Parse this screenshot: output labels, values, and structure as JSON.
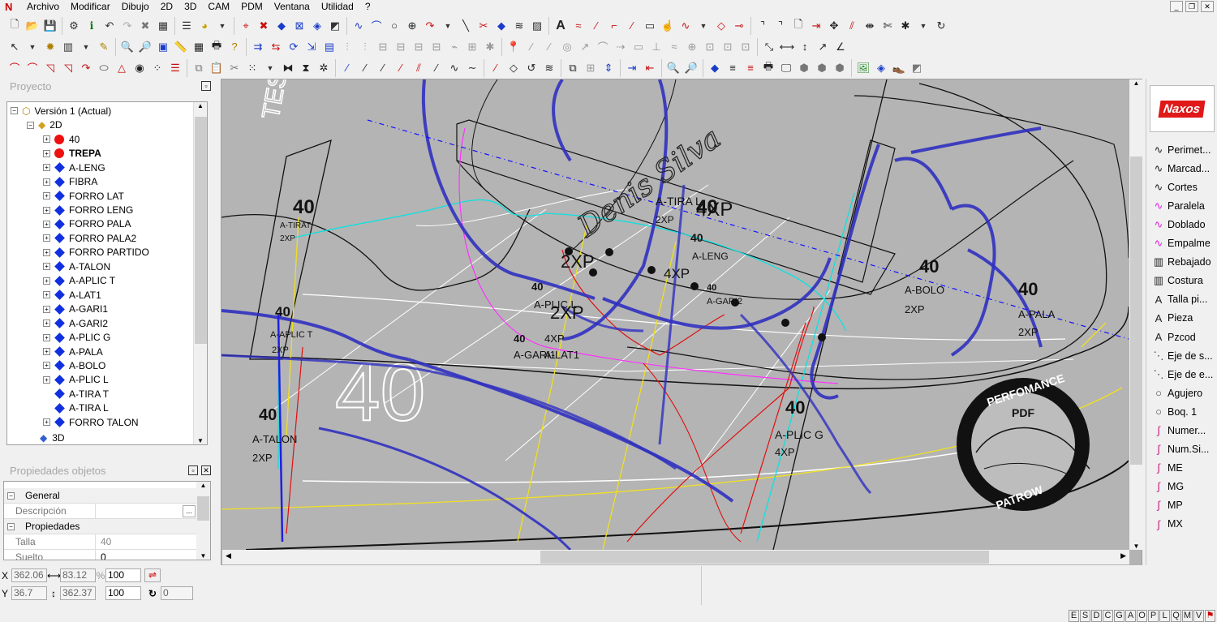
{
  "menu": [
    "Archivo",
    "Modificar",
    "Dibujo",
    "2D",
    "3D",
    "CAM",
    "PDM",
    "Ventana",
    "Utilidad",
    "?"
  ],
  "project_panel": {
    "title": "Proyecto",
    "root": "Versión 1 (Actual)",
    "node_2d": "2D",
    "node_3d": "3D",
    "items": [
      {
        "label": "40",
        "marker": "red-dot",
        "bold": false
      },
      {
        "label": "TREPA",
        "marker": "red-dot",
        "bold": true
      },
      {
        "label": "A-LENG",
        "marker": "blue-diamond",
        "bold": false
      },
      {
        "label": "FIBRA",
        "marker": "blue-diamond",
        "bold": false
      },
      {
        "label": "FORRO LAT",
        "marker": "blue-diamond",
        "bold": false
      },
      {
        "label": "FORRO LENG",
        "marker": "blue-diamond",
        "bold": false
      },
      {
        "label": "FORRO PALA",
        "marker": "blue-diamond",
        "bold": false
      },
      {
        "label": "FORRO PALA2",
        "marker": "blue-diamond",
        "bold": false
      },
      {
        "label": "FORRO PARTIDO",
        "marker": "blue-diamond",
        "bold": false
      },
      {
        "label": "A-TALON",
        "marker": "blue-diamond",
        "bold": false
      },
      {
        "label": "A-APLIC T",
        "marker": "blue-diamond",
        "bold": false
      },
      {
        "label": "A-LAT1",
        "marker": "blue-diamond",
        "bold": false
      },
      {
        "label": "A-GARI1",
        "marker": "blue-diamond",
        "bold": false
      },
      {
        "label": "A-GARI2",
        "marker": "blue-diamond",
        "bold": false
      },
      {
        "label": "A-PLIC G",
        "marker": "blue-diamond",
        "bold": false
      },
      {
        "label": "A-PALA",
        "marker": "blue-diamond",
        "bold": false
      },
      {
        "label": "A-BOLO",
        "marker": "blue-diamond",
        "bold": false
      },
      {
        "label": "A-PLIC L",
        "marker": "blue-diamond",
        "bold": false
      },
      {
        "label": "A-TIRA T",
        "marker": "blue-diamond",
        "bold": false
      },
      {
        "label": "A-TIRA L",
        "marker": "blue-diamond",
        "bold": false
      },
      {
        "label": "FORRO TALON",
        "marker": "blue-diamond",
        "bold": false
      }
    ]
  },
  "properties_panel": {
    "title": "Propiedades objetos",
    "section_general": "General",
    "label_descripcion": "Descripción",
    "value_descripcion": "",
    "section_propiedades": "Propiedades",
    "label_talla": "Talla",
    "value_talla": "40",
    "label_suelto": "Suelto",
    "value_suelto": "0"
  },
  "coords": {
    "x_label": "X",
    "x_value": "362.06",
    "dx_value": "83.12",
    "y_label": "Y",
    "y_value": "36.7",
    "dy_value": "362.37",
    "scale_x": "100",
    "scale_y": "100",
    "rotation": "0"
  },
  "right_panel": {
    "logo": "Naxos",
    "tools": [
      "Perimet...",
      "Marcad...",
      "Cortes",
      "Paralela",
      "Doblado",
      "Empalme",
      "Rebajado",
      "Costura",
      "Talla pi...",
      "Pieza",
      "Pzcod",
      "Eje de s...",
      "Eje de e...",
      "Agujero",
      "Boq. 1",
      "Numer...",
      "Num.Si...",
      "ME",
      "MG",
      "MP",
      "MX"
    ]
  },
  "status_letters": [
    "E",
    "S",
    "D",
    "C",
    "G",
    "A",
    "O",
    "P",
    "L",
    "Q",
    "M",
    "V"
  ],
  "canvas": {
    "labels": [
      {
        "text": "40",
        "kind": "size"
      },
      {
        "text": "A-TIRAT",
        "kind": "piece"
      },
      {
        "text": "2XP",
        "kind": "qty"
      },
      {
        "text": "40",
        "kind": "size"
      },
      {
        "text": "A-APLIC T",
        "kind": "piece"
      },
      {
        "text": "2XP",
        "kind": "qty"
      },
      {
        "text": "40",
        "kind": "size"
      },
      {
        "text": "A-TALON",
        "kind": "piece"
      },
      {
        "text": "2XP",
        "kind": "qty"
      },
      {
        "text": "A-TIRA L",
        "kind": "piece"
      },
      {
        "text": "2XP",
        "kind": "qty"
      },
      {
        "text": "40",
        "kind": "size"
      },
      {
        "text": "40",
        "kind": "size"
      },
      {
        "text": "A-LENG",
        "kind": "piece"
      },
      {
        "text": "2XP",
        "kind": "qty"
      },
      {
        "text": "40",
        "kind": "size"
      },
      {
        "text": "A-PLIC L",
        "kind": "piece"
      },
      {
        "text": "2XP",
        "kind": "qty"
      },
      {
        "text": "40",
        "kind": "size"
      },
      {
        "text": "A-GARI1",
        "kind": "piece"
      },
      {
        "text": "4XP",
        "kind": "qty"
      },
      {
        "text": "A-LAT1",
        "kind": "piece"
      },
      {
        "text": "4XP",
        "kind": "qty"
      },
      {
        "text": "40",
        "kind": "size"
      },
      {
        "text": "A-GARI2",
        "kind": "piece"
      },
      {
        "text": "4XP",
        "kind": "qty"
      },
      {
        "text": "40",
        "kind": "size"
      },
      {
        "text": "A-BOLO",
        "kind": "piece"
      },
      {
        "text": "2XP",
        "kind": "qty"
      },
      {
        "text": "40",
        "kind": "size"
      },
      {
        "text": "A-PALA",
        "kind": "piece"
      },
      {
        "text": "2XP",
        "kind": "qty"
      },
      {
        "text": "40",
        "kind": "size"
      },
      {
        "text": "A-PLIC G",
        "kind": "piece"
      },
      {
        "text": "4XP",
        "kind": "qty"
      }
    ],
    "big_outline_number": "40",
    "watermark_text": "TES",
    "stamp_top": "PERFOMANCE",
    "stamp_middle": "PDF",
    "stamp_bottom": "PATROW"
  }
}
